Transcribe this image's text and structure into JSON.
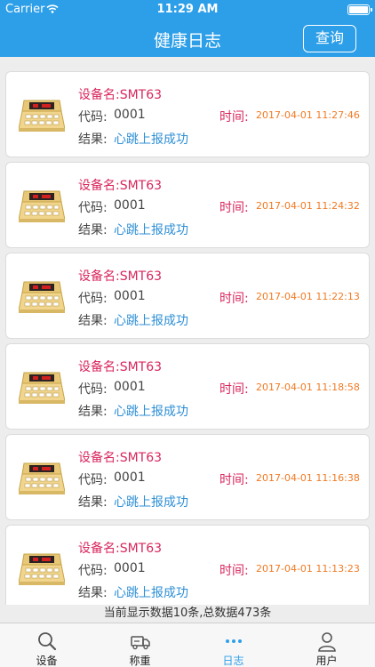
{
  "status_bar": {
    "carrier": "Carrier",
    "time": "11:29 AM"
  },
  "header": {
    "title": "健康日志",
    "query_label": "查询"
  },
  "colors": {
    "accent": "#2d9fe8",
    "device_label": "#d9265d",
    "time_value": "#f07a23",
    "result_value": "#2e8fd6"
  },
  "labels": {
    "device": "设备名:",
    "code": "代码:",
    "time": "时间:",
    "result": "结果:"
  },
  "logs": [
    {
      "device": "SMT63",
      "code": "0001",
      "time": "2017-04-01 11:27:46",
      "result": "心跳上报成功"
    },
    {
      "device": "SMT63",
      "code": "0001",
      "time": "2017-04-01 11:24:32",
      "result": "心跳上报成功"
    },
    {
      "device": "SMT63",
      "code": "0001",
      "time": "2017-04-01 11:22:13",
      "result": "心跳上报成功"
    },
    {
      "device": "SMT63",
      "code": "0001",
      "time": "2017-04-01 11:18:58",
      "result": "心跳上报成功"
    },
    {
      "device": "SMT63",
      "code": "0001",
      "time": "2017-04-01 11:16:38",
      "result": "心跳上报成功"
    },
    {
      "device": "SMT63",
      "code": "0001",
      "time": "2017-04-01 11:13:23",
      "result": "心跳上报成功"
    }
  ],
  "footer": {
    "summary": "当前显示数据10条,总数据473条"
  },
  "tabs": [
    {
      "label": "设备",
      "icon": "search-icon"
    },
    {
      "label": "称重",
      "icon": "truck-icon"
    },
    {
      "label": "日志",
      "icon": "more-dots-icon",
      "active": true
    },
    {
      "label": "用户",
      "icon": "user-icon"
    }
  ]
}
